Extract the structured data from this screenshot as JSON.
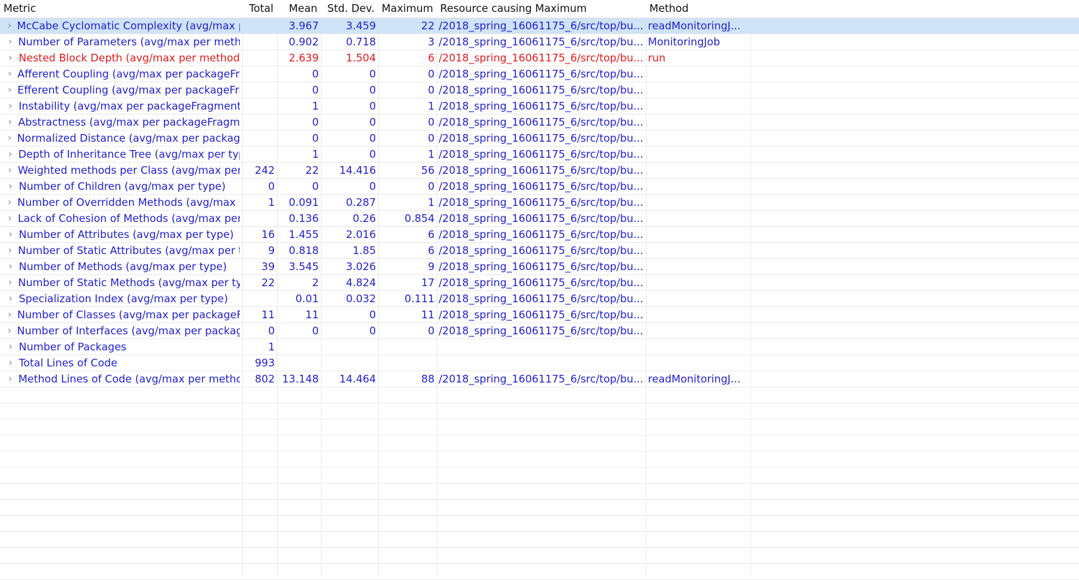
{
  "columns": [
    "Metric",
    "Total",
    "Mean",
    "Std. Dev.",
    "Maximum",
    "Resource causing Maximum",
    "Method"
  ],
  "rows": [
    {
      "metric": "McCabe Cyclomatic Complexity (avg/max per method)",
      "total": "",
      "mean": "3.967",
      "std": "3.459",
      "max": "22",
      "resource": "/2018_spring_16061175_6/src/top/bu...",
      "method": "readMonitoringJ...",
      "selected": true
    },
    {
      "metric": "Number of Parameters (avg/max per method)",
      "total": "",
      "mean": "0.902",
      "std": "0.718",
      "max": "3",
      "resource": "/2018_spring_16061175_6/src/top/bu...",
      "method": "MonitoringJob"
    },
    {
      "metric": "Nested Block Depth (avg/max per method)",
      "total": "",
      "mean": "2.639",
      "std": "1.504",
      "max": "6",
      "resource": "/2018_spring_16061175_6/src/top/bu...",
      "method": "run",
      "warn": true
    },
    {
      "metric": "Afferent Coupling (avg/max per packageFragment)",
      "total": "",
      "mean": "0",
      "std": "0",
      "max": "0",
      "resource": "/2018_spring_16061175_6/src/top/bu...",
      "method": ""
    },
    {
      "metric": "Efferent Coupling (avg/max per packageFragment)",
      "total": "",
      "mean": "0",
      "std": "0",
      "max": "0",
      "resource": "/2018_spring_16061175_6/src/top/bu...",
      "method": ""
    },
    {
      "metric": "Instability (avg/max per packageFragment)",
      "total": "",
      "mean": "1",
      "std": "0",
      "max": "1",
      "resource": "/2018_spring_16061175_6/src/top/bu...",
      "method": ""
    },
    {
      "metric": "Abstractness (avg/max per packageFragment)",
      "total": "",
      "mean": "0",
      "std": "0",
      "max": "0",
      "resource": "/2018_spring_16061175_6/src/top/bu...",
      "method": ""
    },
    {
      "metric": "Normalized Distance (avg/max per packageFragment)",
      "total": "",
      "mean": "0",
      "std": "0",
      "max": "0",
      "resource": "/2018_spring_16061175_6/src/top/bu...",
      "method": ""
    },
    {
      "metric": "Depth of Inheritance Tree (avg/max per type)",
      "total": "",
      "mean": "1",
      "std": "0",
      "max": "1",
      "resource": "/2018_spring_16061175_6/src/top/bu...",
      "method": ""
    },
    {
      "metric": "Weighted methods per Class (avg/max per type)",
      "total": "242",
      "mean": "22",
      "std": "14.416",
      "max": "56",
      "resource": "/2018_spring_16061175_6/src/top/bu...",
      "method": ""
    },
    {
      "metric": "Number of Children (avg/max per type)",
      "total": "0",
      "mean": "0",
      "std": "0",
      "max": "0",
      "resource": "/2018_spring_16061175_6/src/top/bu...",
      "method": ""
    },
    {
      "metric": "Number of Overridden Methods (avg/max per type)",
      "total": "1",
      "mean": "0.091",
      "std": "0.287",
      "max": "1",
      "resource": "/2018_spring_16061175_6/src/top/bu...",
      "method": ""
    },
    {
      "metric": "Lack of Cohesion of Methods (avg/max per type)",
      "total": "",
      "mean": "0.136",
      "std": "0.26",
      "max": "0.854",
      "resource": "/2018_spring_16061175_6/src/top/bu...",
      "method": ""
    },
    {
      "metric": "Number of Attributes (avg/max per type)",
      "total": "16",
      "mean": "1.455",
      "std": "2.016",
      "max": "6",
      "resource": "/2018_spring_16061175_6/src/top/bu...",
      "method": ""
    },
    {
      "metric": "Number of Static Attributes (avg/max per type)",
      "total": "9",
      "mean": "0.818",
      "std": "1.85",
      "max": "6",
      "resource": "/2018_spring_16061175_6/src/top/bu...",
      "method": ""
    },
    {
      "metric": "Number of Methods (avg/max per type)",
      "total": "39",
      "mean": "3.545",
      "std": "3.026",
      "max": "9",
      "resource": "/2018_spring_16061175_6/src/top/bu...",
      "method": ""
    },
    {
      "metric": "Number of Static Methods (avg/max per type)",
      "total": "22",
      "mean": "2",
      "std": "4.824",
      "max": "17",
      "resource": "/2018_spring_16061175_6/src/top/bu...",
      "method": ""
    },
    {
      "metric": "Specialization Index (avg/max per type)",
      "total": "",
      "mean": "0.01",
      "std": "0.032",
      "max": "0.111",
      "resource": "/2018_spring_16061175_6/src/top/bu...",
      "method": ""
    },
    {
      "metric": "Number of Classes (avg/max per packageFragment)",
      "total": "11",
      "mean": "11",
      "std": "0",
      "max": "11",
      "resource": "/2018_spring_16061175_6/src/top/bu...",
      "method": ""
    },
    {
      "metric": "Number of Interfaces (avg/max per packageFragment)",
      "total": "0",
      "mean": "0",
      "std": "0",
      "max": "0",
      "resource": "/2018_spring_16061175_6/src/top/bu...",
      "method": ""
    },
    {
      "metric": "Number of Packages",
      "total": "1",
      "mean": "",
      "std": "",
      "max": "",
      "resource": "",
      "method": ""
    },
    {
      "metric": "Total Lines of Code",
      "total": "993",
      "mean": "",
      "std": "",
      "max": "",
      "resource": "",
      "method": ""
    },
    {
      "metric": "Method Lines of Code (avg/max per method)",
      "total": "802",
      "mean": "13.148",
      "std": "14.464",
      "max": "88",
      "resource": "/2018_spring_16061175_6/src/top/bu...",
      "method": "readMonitoringJ..."
    }
  ],
  "expand_icon": "chevron-right-icon",
  "colors": {
    "text": "#1f1fcc",
    "warning": "#e41b1b",
    "selection": "#cfe3f6",
    "grid": "#ececec"
  }
}
